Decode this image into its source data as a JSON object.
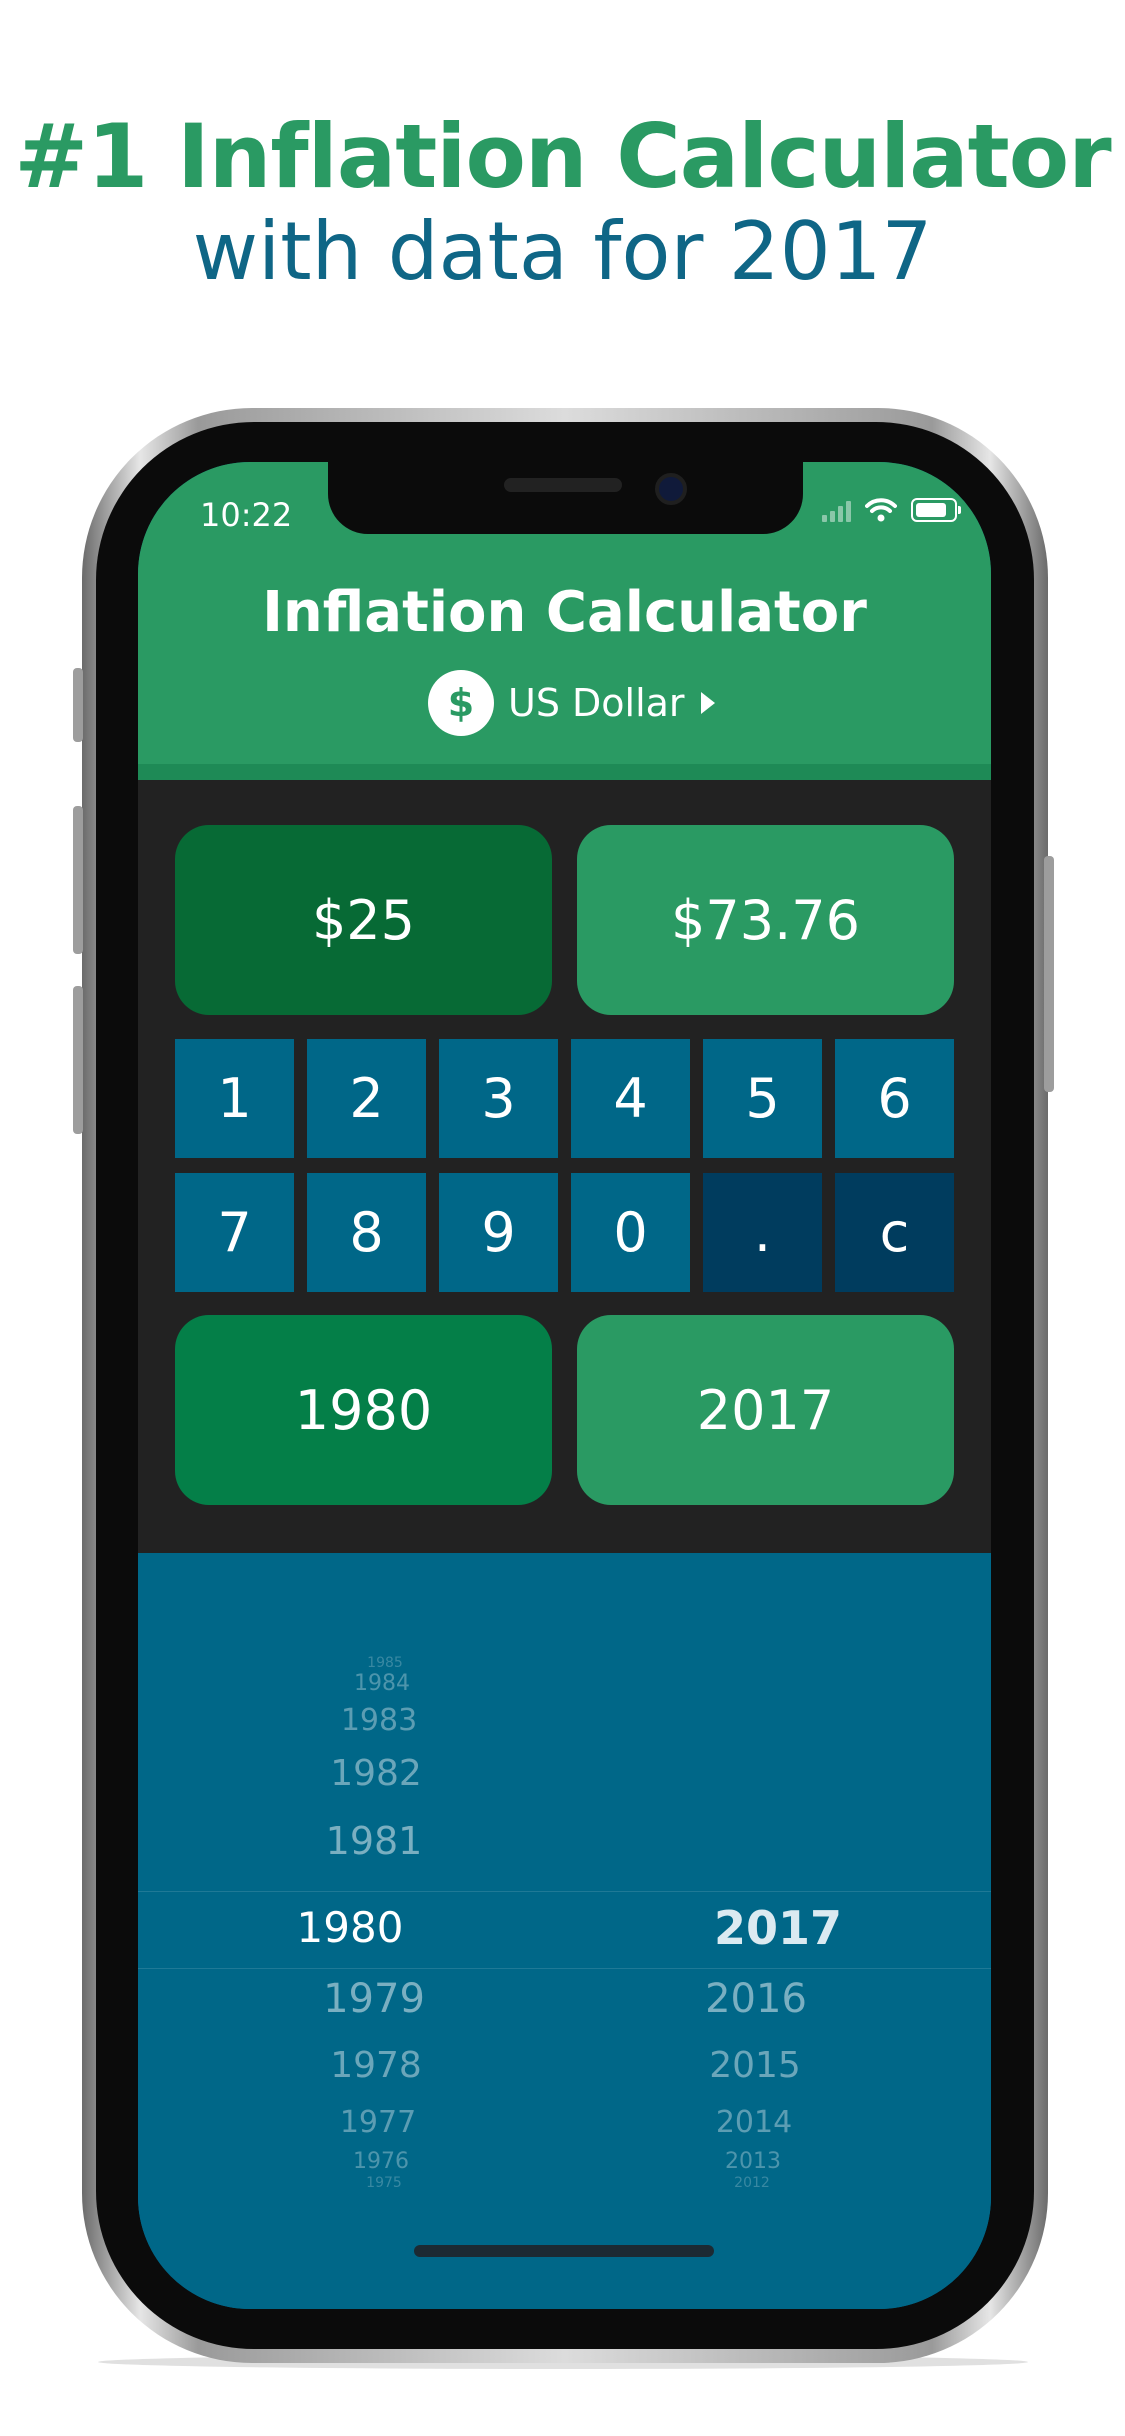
{
  "promo": {
    "title": "#1 Inflation Calculator",
    "subtitle": "with data for 2017"
  },
  "status_bar": {
    "time": "10:22"
  },
  "header": {
    "title": "Inflation Calculator",
    "currency_symbol": "$",
    "currency_label": "US Dollar"
  },
  "amounts": {
    "from_value": "$25",
    "to_value": "$73.76"
  },
  "keypad": {
    "row1": [
      "1",
      "2",
      "3",
      "4",
      "5",
      "6"
    ],
    "row2": [
      "7",
      "8",
      "9",
      "0",
      ".",
      "c"
    ]
  },
  "years": {
    "from_year": "1980",
    "to_year": "2017"
  },
  "picker": {
    "left_above": [
      "1985",
      "1984",
      "1983",
      "1982",
      "1981"
    ],
    "left_selected": "1980",
    "left_below": [
      "1979",
      "1978",
      "1977",
      "1976",
      "1975"
    ],
    "right_selected": "2017",
    "right_below": [
      "2016",
      "2015",
      "2014",
      "2013",
      "2012"
    ]
  },
  "colors": {
    "brand_green": "#2a9a63",
    "dark_green": "#076a35",
    "year_green": "#047f48",
    "key_blue": "#006788",
    "key_dark_blue": "#003c5e",
    "panel_bg": "#222222",
    "subtitle_blue": "#0f6686"
  },
  "icons": [
    "dollar-icon",
    "play-arrow-icon",
    "signal-icon",
    "wifi-icon",
    "battery-icon"
  ]
}
